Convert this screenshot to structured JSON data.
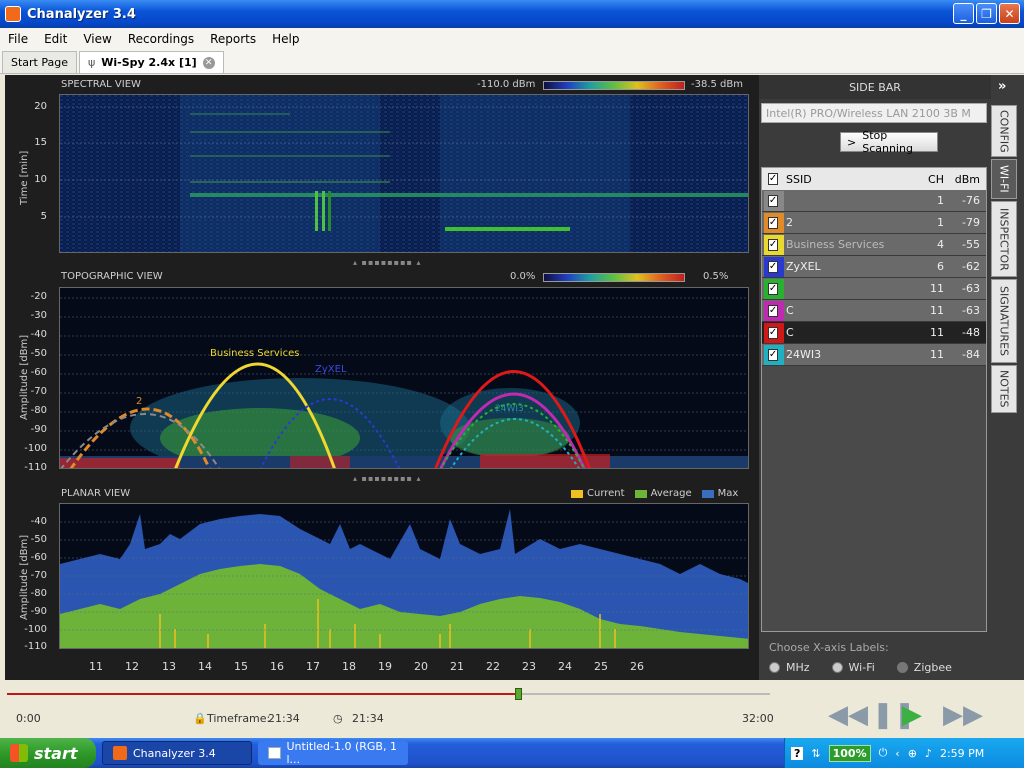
{
  "window": {
    "title": "Chanalyzer 3.4"
  },
  "menu": [
    "File",
    "Edit",
    "View",
    "Recordings",
    "Reports",
    "Help"
  ],
  "tabs": {
    "start": "Start Page",
    "active": "Wi-Spy 2.4x [1]"
  },
  "spectral": {
    "label": "SPECTRAL VIEW",
    "scale_min": "-110.0 dBm",
    "scale_max": "-38.5 dBm",
    "ylabel": "Time [min]",
    "yticks": [
      "20",
      "15",
      "10",
      "5"
    ]
  },
  "topo": {
    "label": "TOPOGRAPHIC VIEW",
    "scale_min": "0.0%",
    "scale_max": "0.5%",
    "ylabel": "Amplitude [dBm]",
    "yticks": [
      "-20",
      "-30",
      "-40",
      "-50",
      "-60",
      "-70",
      "-80",
      "-90",
      "-100",
      "-110"
    ],
    "network_labels": [
      "Business Services",
      "ZyXEL",
      "24WI3",
      "2"
    ]
  },
  "planar": {
    "label": "PLANAR VIEW",
    "legend": [
      "Current",
      "Average",
      "Max"
    ],
    "ylabel": "Amplitude [dBm]",
    "yticks": [
      "-40",
      "-50",
      "-60",
      "-70",
      "-80",
      "-90",
      "-100",
      "-110"
    ],
    "xticks": [
      "11",
      "12",
      "13",
      "14",
      "15",
      "16",
      "17",
      "18",
      "19",
      "20",
      "21",
      "22",
      "23",
      "24",
      "25",
      "26"
    ]
  },
  "colors": {
    "current": "#f0c020",
    "average": "#6db33a",
    "max": "#3a6dbd"
  },
  "sidebar": {
    "header": "SIDE BAR",
    "adapter": "Intel(R) PRO/Wireless LAN 2100 3B M",
    "stop_button": "Stop Scanning",
    "vtabs": [
      "CONFIG",
      "WI-FI",
      "INSPECTOR",
      "SIGNATURES",
      "NOTES"
    ],
    "columns": {
      "ssid": "SSID",
      "ch": "CH",
      "dbm": "dBm"
    },
    "networks": [
      {
        "ssid": "",
        "ch": "1",
        "dbm": "-76",
        "color": "#888888"
      },
      {
        "ssid": "2",
        "ch": "1",
        "dbm": "-79",
        "color": "#e08a2a"
      },
      {
        "ssid": "Business Services",
        "ch": "4",
        "dbm": "-55",
        "color": "#e8d830"
      },
      {
        "ssid": "ZyXEL",
        "ch": "6",
        "dbm": "-62",
        "color": "#2a3ad0"
      },
      {
        "ssid": "",
        "ch": "11",
        "dbm": "-63",
        "color": "#2ab030"
      },
      {
        "ssid": "C",
        "ch": "11",
        "dbm": "-63",
        "color": "#c02ab0"
      },
      {
        "ssid": "C",
        "ch": "11",
        "dbm": "-48",
        "color": "#d01818"
      },
      {
        "ssid": "24WI3",
        "ch": "11",
        "dbm": "-84",
        "color": "#20b0c0"
      }
    ],
    "xaxis_label": "Choose X-axis Labels:",
    "xaxis_options": [
      "MHz",
      "Wi-Fi",
      "Zigbee"
    ]
  },
  "timeline": {
    "start": "0:00",
    "timeframe_label": "Timeframe:",
    "timeframe": "21:34",
    "current": "21:34",
    "end": "32:00",
    "progress": 0.67
  },
  "taskbar": {
    "start": "start",
    "items": [
      "Chanalyzer 3.4",
      "Untitled-1.0 (RGB, 1 l..."
    ],
    "battery": "100%",
    "clock": "2:59 PM"
  }
}
